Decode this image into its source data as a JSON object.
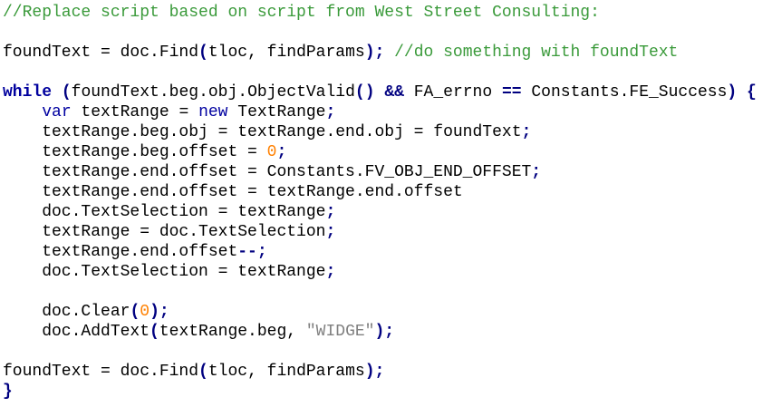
{
  "code": {
    "line1": "//Replace script based on script from West Street Consulting:",
    "line3_a": "foundText = doc.Find",
    "line3_b": "(",
    "line3_c": "tloc, findParams",
    "line3_d": ");",
    "line3_e": " //do something with foundText",
    "line5_a": "while",
    "line5_b": " ",
    "line5_c": "(",
    "line5_d": "foundText.beg.obj.ObjectValid",
    "line5_e": "()",
    "line5_f": " ",
    "line5_g": "&&",
    "line5_h": " FA_errno ",
    "line5_i": "==",
    "line5_j": " Constants.FE_Success",
    "line5_k": ")",
    "line5_l": " ",
    "line5_m": "{",
    "line6_a": "    ",
    "line6_b": "var",
    "line6_c": " textRange = ",
    "line6_d": "new",
    "line6_e": " TextRange",
    "line6_f": ";",
    "line7_a": "    textRange.beg.obj = textRange.end.obj = foundText",
    "line7_b": ";",
    "line8_a": "    textRange.beg.offset = ",
    "line8_b": "0",
    "line8_c": ";",
    "line9_a": "    textRange.end.offset = Constants.FV_OBJ_END_OFFSET",
    "line9_b": ";",
    "line10": "    textRange.end.offset = textRange.end.offset",
    "line11_a": "    doc.TextSelection = textRange",
    "line11_b": ";",
    "line12_a": "    textRange = doc.TextSelection",
    "line12_b": ";",
    "line13_a": "    textRange.end.offset",
    "line13_b": "--;",
    "line14_a": "    doc.TextSelection = textRange",
    "line14_b": ";",
    "line16_a": "    doc.Clear",
    "line16_b": "(",
    "line16_c": "0",
    "line16_d": ");",
    "line17_a": "    doc.AddText",
    "line17_b": "(",
    "line17_c": "textRange.beg, ",
    "line17_d": "\"WIDGE\"",
    "line17_e": ");",
    "line19_a": "foundText = doc.Find",
    "line19_b": "(",
    "line19_c": "tloc, findParams",
    "line19_d": ");",
    "line20": "}"
  },
  "colors": {
    "comment": "#3a9a3a",
    "keyword": "#00009e",
    "number": "#ff8000",
    "string": "#808080",
    "background": "#ffffff"
  }
}
